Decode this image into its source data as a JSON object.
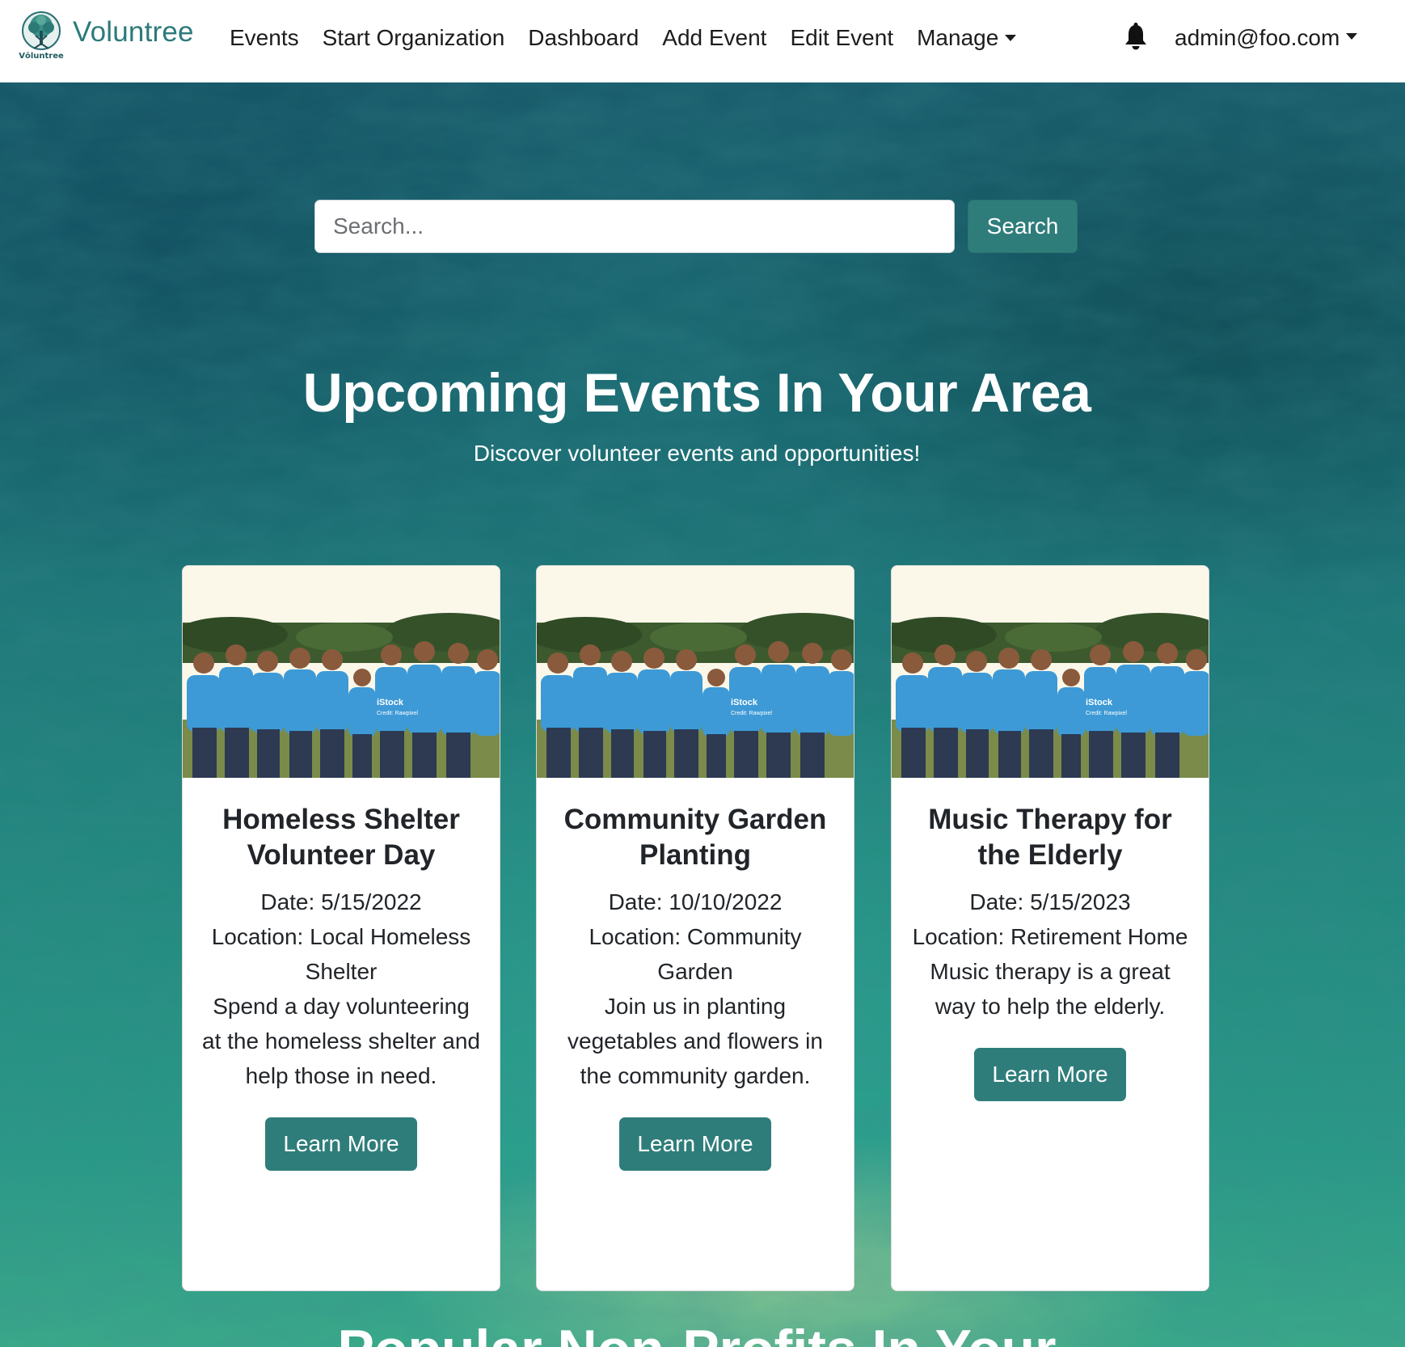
{
  "brand": {
    "name": "Voluntree",
    "logo_caption": "Vōluntree"
  },
  "nav": {
    "items": [
      {
        "label": "Events"
      },
      {
        "label": "Start Organization"
      },
      {
        "label": "Dashboard"
      },
      {
        "label": "Add Event"
      },
      {
        "label": "Edit Event"
      },
      {
        "label": "Manage"
      }
    ],
    "user_email": "admin@foo.com",
    "icons": {
      "notifications": "bell-icon",
      "dropdown": "caret-down-icon"
    }
  },
  "search": {
    "placeholder": "Search...",
    "value": "",
    "button_label": "Search"
  },
  "hero": {
    "title": "Upcoming Events In Your Area",
    "subtitle": "Discover volunteer events and opportunities!"
  },
  "events": [
    {
      "title": "Homeless Shelter Volunteer Day",
      "date": "Date: 5/15/2022",
      "location": "Location: Local Homeless Shelter",
      "description": "Spend a day volunteering at the homeless shelter and help those in need.",
      "button_label": "Learn More",
      "image_watermark": "iStock",
      "image_credit": "Credit: Rawpixel"
    },
    {
      "title": "Community Garden Planting",
      "date": "Date: 10/10/2022",
      "location": "Location: Community Garden",
      "description": "Join us in planting vegetables and flowers in the community garden.",
      "button_label": "Learn More",
      "image_watermark": "iStock",
      "image_credit": "Credit: Rawpixel"
    },
    {
      "title": "Music Therapy for the Elderly",
      "date": "Date: 5/15/2023",
      "location": "Location: Retirement Home",
      "description": "Music therapy is a great way to help the elderly.",
      "button_label": "Learn More",
      "image_watermark": "iStock",
      "image_credit": "Credit: Rawpixel"
    }
  ],
  "next_section": {
    "title": "Popular Non-Profits In Your"
  },
  "colors": {
    "accent": "#2f7d7b",
    "brand_text": "#2c7a7b",
    "navbar_bg": "#ffffff",
    "card_bg": "#ffffff",
    "volunteer_shirt": "#3d9ad6"
  }
}
